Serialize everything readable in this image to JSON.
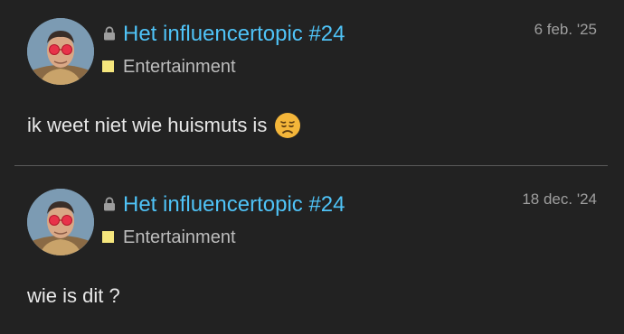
{
  "posts": [
    {
      "topic_title": "Het influencertopic #24",
      "category": "Entertainment",
      "category_color": "#f5e67d",
      "date": "6 feb. '25",
      "body": "ik weet niet wie huismuts is",
      "emoji": "disappointed-face"
    },
    {
      "topic_title": "Het influencertopic #24",
      "category": "Entertainment",
      "category_color": "#f5e67d",
      "date": "18 dec. '24",
      "body": "wie is dit ?"
    }
  ],
  "colors": {
    "background": "#222222",
    "link": "#4fc3f7",
    "divider": "#5a5a5a"
  }
}
